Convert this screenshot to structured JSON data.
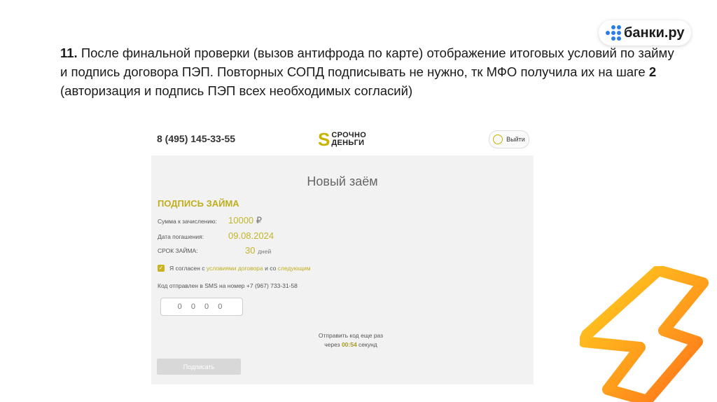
{
  "slide": {
    "step_number": "11.",
    "text_1": " После финальной проверки (вызов антифрода по карте) отображение итоговых условий по займу и подпись договора ПЭП. Повторных СОПД подписывать не нужно, тк МФО получила их на шаге ",
    "step_ref": "2",
    "text_2": " (авторизация и подпись ПЭП всех необходимых согласий)"
  },
  "logo": {
    "label": "банки.ру",
    "color": "#2b7de9"
  },
  "app": {
    "phone": "8 (495) 145-33-55",
    "brand_line1": "СРОЧНО",
    "brand_line2": "ДЕНЬГИ",
    "exit_label": "Выйти",
    "page_title": "Новый заём",
    "section_title": "ПОДПИСЬ ЗАЙМА",
    "amount_label": "Сумма к зачислению:",
    "amount_value": "10000",
    "amount_currency": "₽",
    "date_label": "Дата погашения:",
    "date_value": "09.08.2024",
    "term_label": "СРОК ЗАЙМА:",
    "term_value": "30",
    "term_unit": "дней",
    "agree_prefix": "Я согласен с ",
    "agree_link1": "условиями договора",
    "agree_mid": " и со ",
    "agree_link2": "следующим",
    "sms_text": "Код отправлен в SMS на номер +7 (967) 733-31-58",
    "code_placeholder": "0 0 0 0",
    "resend_line1": "Отправить код еще раз",
    "resend_prefix": "через ",
    "resend_timer": "00:54",
    "resend_suffix": " секунд",
    "sign_label": "Подписать",
    "accent_color": "#c7b400"
  }
}
